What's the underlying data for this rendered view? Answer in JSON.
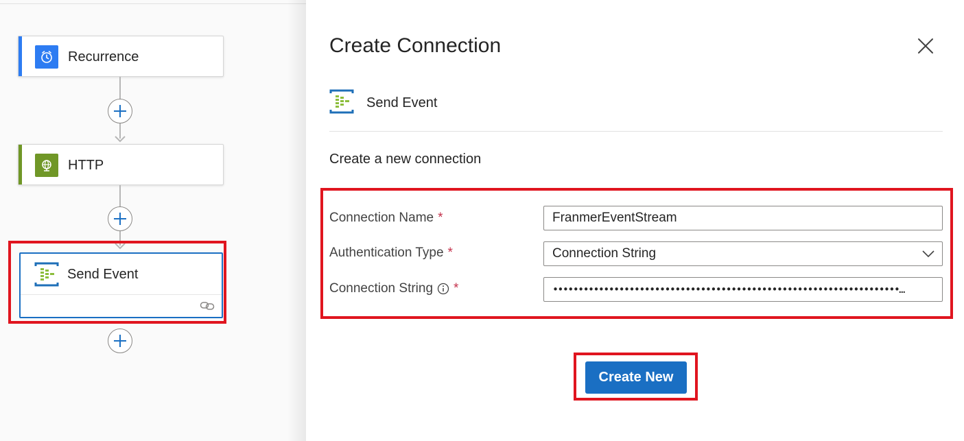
{
  "workflow": {
    "steps": [
      {
        "label": "Recurrence",
        "icon": "clock-icon",
        "accent": "#2d7cf2",
        "icon_bg": "#2d7cf2"
      },
      {
        "label": "HTTP",
        "icon": "globe-icon",
        "accent": "#709727",
        "icon_bg": "#709727"
      },
      {
        "label": "Send Event",
        "icon": "event-hub-icon",
        "accent": "#1a6fc3"
      }
    ]
  },
  "panel": {
    "title": "Create Connection",
    "action_name": "Send Event",
    "section_title": "Create a new connection",
    "fields": {
      "connection_name": {
        "label": "Connection Name",
        "required_mark": "*",
        "value": "FranmerEventStream"
      },
      "auth_type": {
        "label": "Authentication Type",
        "required_mark": "*",
        "selected": "Connection String"
      },
      "connection_string": {
        "label": "Connection String",
        "required_mark": "*",
        "masked_value": "••••••••••••••••••••••••••••••••••••••••••••••••••••••••••••••••••••…"
      }
    },
    "create_button_label": "Create New"
  },
  "colors": {
    "primary": "#1a6fc3",
    "highlight_border": "#e0151f",
    "required": "#c4314b"
  }
}
